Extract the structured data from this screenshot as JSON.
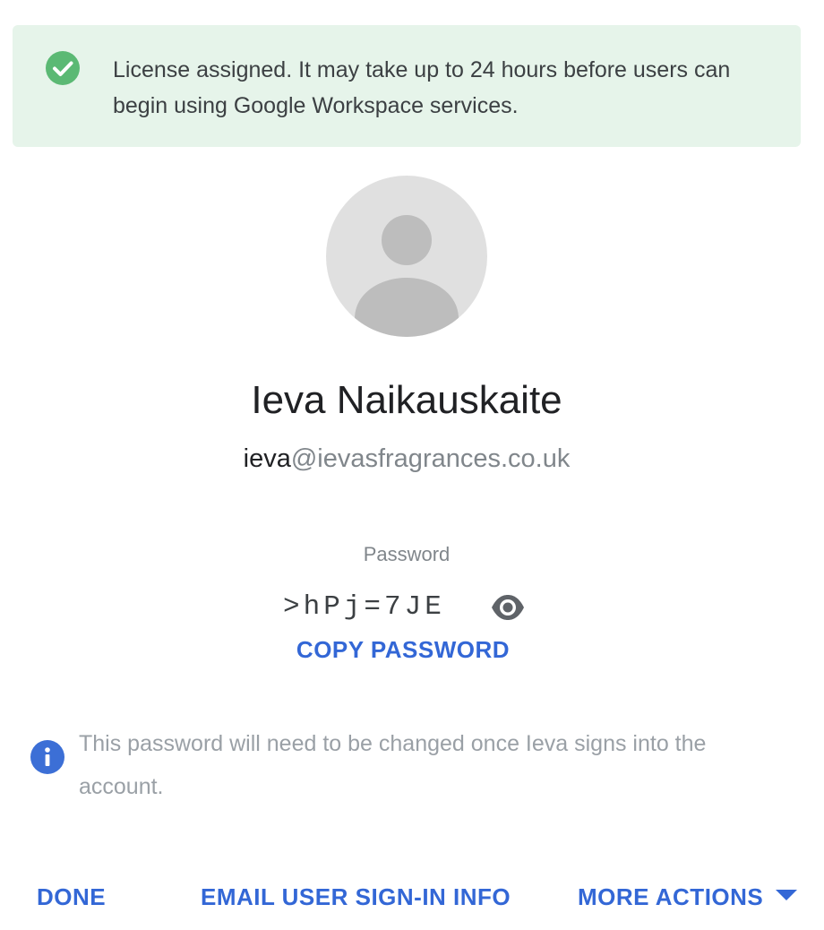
{
  "banner": {
    "message": "License assigned. It may take up to 24 hours before users can begin using Google Workspace services.",
    "icon": "check-circle-icon",
    "background_color": "#e6f4ea",
    "icon_color": "#5bb974"
  },
  "user": {
    "avatar_icon": "default-person-avatar-icon",
    "first_name": "Ieva",
    "last_name": "Naikauskaite",
    "email_local": "ieva",
    "email_domain": "@ievasfragrances.co.uk"
  },
  "password": {
    "label": "Password",
    "value": ">hPj=7JE",
    "toggle_icon": "eye-icon",
    "copy_label": "COPY PASSWORD"
  },
  "notice": {
    "icon": "info-icon",
    "text": "This password will need to be changed once Ieva signs into the account."
  },
  "actions": {
    "done_label": "DONE",
    "email_label": "EMAIL USER SIGN-IN INFO",
    "more_label": "MORE ACTIONS",
    "more_icon": "caret-down-icon"
  },
  "colors": {
    "accent": "#3367d6",
    "info_icon": "#3c6fd6"
  }
}
